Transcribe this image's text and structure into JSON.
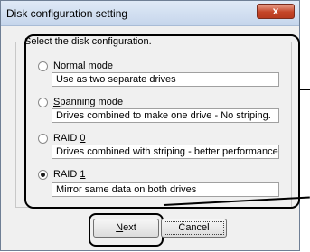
{
  "window": {
    "title": "Disk configuration setting",
    "close_glyph": "x"
  },
  "group": {
    "label": "Select the disk configuration."
  },
  "options": [
    {
      "pre": "Norma",
      "key": "l",
      "post": " mode",
      "desc": "Use as two separate drives",
      "selected": false
    },
    {
      "pre": "",
      "key": "S",
      "post": "panning mode",
      "desc": "Drives combined to make one drive - No striping.",
      "selected": false
    },
    {
      "pre": "RAID ",
      "key": "0",
      "post": "",
      "desc": "Drives combined with striping - better performance.",
      "selected": false
    },
    {
      "pre": "RAID ",
      "key": "1",
      "post": "",
      "desc": "Mirror same data on both drives",
      "selected": true
    }
  ],
  "buttons": {
    "next": {
      "key": "N",
      "rest": "ext"
    },
    "cancel": {
      "label": "Cancel"
    }
  }
}
